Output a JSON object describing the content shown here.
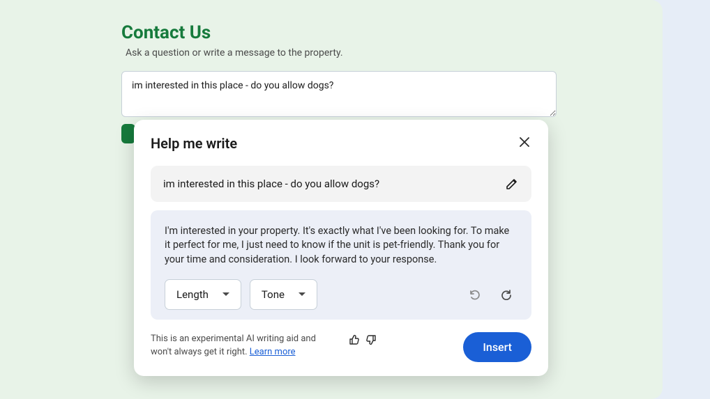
{
  "page": {
    "title": "Contact Us",
    "subtitle": "Ask a question or write a message to the property.",
    "textarea_value": "im interested in this place - do you allow dogs?"
  },
  "popover": {
    "title": "Help me write",
    "user_input": "im interested in this place - do you allow dogs?",
    "suggestion": "I'm interested in your property. It's exactly what I've been looking for. To make it perfect for me, I just need to know if the unit is pet-friendly. Thank you for your time and consideration. I look forward to your response.",
    "length_label": "Length",
    "tone_label": "Tone",
    "disclaimer_part1": "This is an experimental AI writing aid and won't always get it right. ",
    "learn_more": "Learn more",
    "insert_label": "Insert"
  }
}
